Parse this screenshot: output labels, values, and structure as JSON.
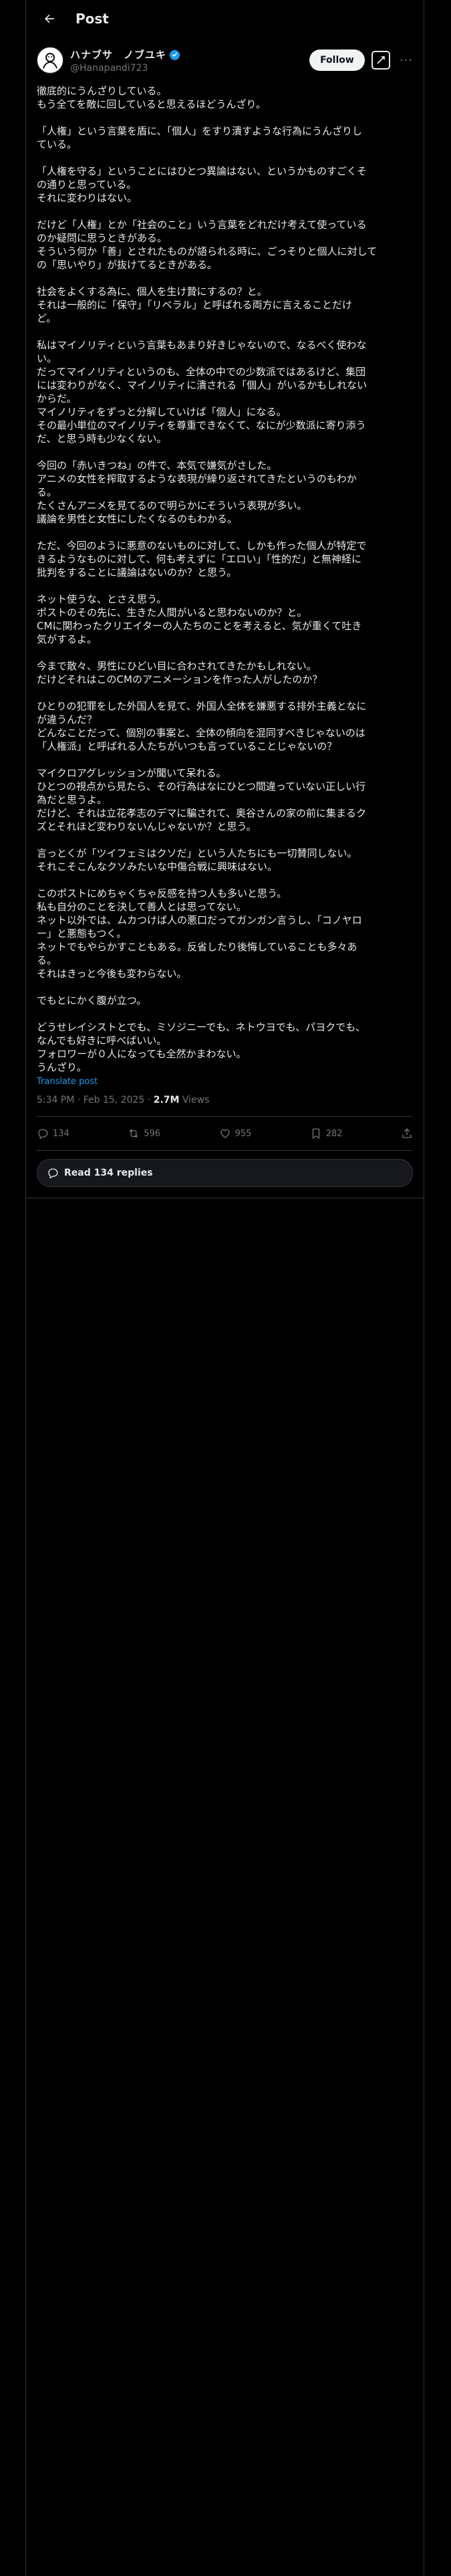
{
  "header": {
    "title": "Post"
  },
  "author": {
    "display_name": "ハナブサ　ノブユキ",
    "handle": "@Hanapandi723",
    "follow_label": "Follow"
  },
  "post": {
    "paragraphs": [
      [
        "徹底的にうんざりしている。",
        "もう全てを敵に回していると思えるほどうんざり。"
      ],
      [
        "「人権」という言葉を盾に、「個人」をすり潰すような行為にうんざりし",
        "ている。"
      ],
      [
        "「人権を守る」ということにはひとつ異論はない、というかものすごくそ",
        "の通りと思っている。",
        "それに変わりはない。"
      ],
      [
        "だけど「人権」とか「社会のこと」いう言葉をどれだけ考えて使っている",
        "のか疑問に思うときがある。",
        "そういう何か「善」とされたものが語られる時に、ごっそりと個人に対して",
        "の「思いやり」が抜けてるときがある。"
      ],
      [
        "社会をよくする為に、個人を生け贄にするの？と。",
        "それは一般的に「保守」「リベラル」と呼ばれる両方に言えることだけ",
        "ど。"
      ],
      [
        "私はマイノリティという言葉もあまり好きじゃないので、なるべく使わな",
        "い。",
        "だってマイノリティというのも、全体の中での少数派ではあるけど、集団",
        "には変わりがなく、マイノリティに潰される「個人」がいるかもしれない",
        "からだ。",
        "マイノリティをずっと分解していけば「個人」になる。",
        "その最小単位のマイノリティを尊重できなくて、なにが少数派に寄り添う",
        "だ、と思う時も少なくない。"
      ],
      [
        "今回の「赤いきつね」の件で、本気で嫌気がさした。",
        "アニメの女性を搾取するような表現が繰り返されてきたというのもわか",
        "る。",
        "たくさんアニメを見てるので明らかにそういう表現が多い。",
        "議論を男性と女性にしたくなるのもわかる。"
      ],
      [
        "ただ、今回のように悪意のないものに対して、しかも作った個人が特定で",
        "きるようなものに対して、何も考えずに「エロい」「性的だ」と無神経に",
        "批判をすることに議論はないのか？と思う。"
      ],
      [
        "ネット使うな、とさえ思う。",
        "ポストのその先に、生きた人間がいると思わないのか？と。",
        "CMに関わったクリエイターの人たちのことを考えると、気が重くて吐き",
        "気がするよ。"
      ],
      [
        "今まで散々、男性にひどい目に合わされてきたかもしれない。",
        "だけどそれはこのCMのアニメーションを作った人がしたのか？"
      ],
      [
        "ひとりの犯罪をした外国人を見て、外国人全体を嫌悪する排外主義となに",
        "が違うんだ？",
        "どんなことだって、個別の事案と、全体の傾向を混同すべきじゃないのは",
        "「人権派」と呼ばれる人たちがいつも言っていることじゃないの？"
      ],
      [
        "マイクロアグレッションが聞いて呆れる。",
        "ひとつの視点から見たら、その行為はなにひとつ間違っていない正しい行",
        "為だと思うよ。",
        "だけど、それは立花孝志のデマに騙されて、奥谷さんの家の前に集まるク",
        "ズとそれほど変わりないんじゃないか？と思う。"
      ],
      [
        "言っとくが「ツイフェミはクソだ」という人たちにも一切賛同しない。",
        "それこそこんなクソみたいな中傷合戦に興味はない。"
      ],
      [
        "このポストにめちゃくちゃ反感を持つ人も多いと思う。",
        "私も自分のことを決して善人とは思ってない。",
        "ネット以外では、ムカつけば人の悪口だってガンガン言うし、「コノヤロ",
        "ー」と悪態もつく。",
        "ネットでもやらかすこともある。反省したり後悔していることも多々あ",
        "る。",
        "それはきっと今後も変わらない。"
      ],
      [
        "でもとにかく腹が立つ。"
      ],
      [
        "どうせレイシストとでも、ミソジニーでも、ネトウヨでも、パヨクでも、",
        "なんでも好きに呼べばいい。",
        "フォロワーが０人になっても全然かまわない。",
        "うんざり。"
      ]
    ],
    "translate_label": "Translate post",
    "timestamp": "5:34 PM · Feb 15, 2025 · ",
    "views_count": "2.7M",
    "views_label": " Views"
  },
  "actions": {
    "replies": "134",
    "reposts": "596",
    "likes": "955",
    "bookmarks": "282"
  },
  "read_replies_label": "Read 134 replies"
}
